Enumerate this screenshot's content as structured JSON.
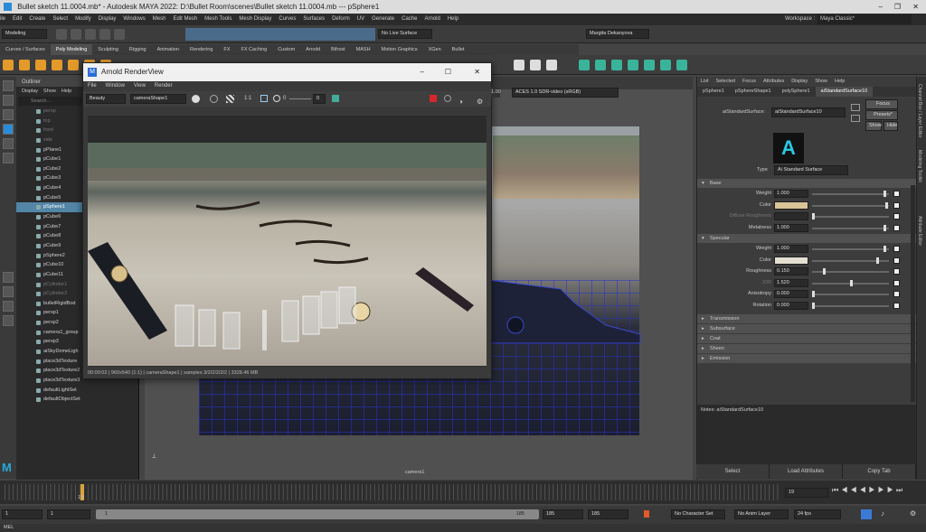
{
  "window": {
    "title": "Bullet sketch 11.0004.mb* - Autodesk MAYA 2022: D:\\Bullet Room\\scenes\\Bullet sketch 11.0004.mb  ---  pSphere1",
    "minimize": "–",
    "maximize": "❐",
    "close": "✕"
  },
  "menubar": [
    "ile",
    "Edit",
    "Create",
    "Select",
    "Modify",
    "Display",
    "Windows",
    "Mesh",
    "Edit Mesh",
    "Mesh Tools",
    "Mesh Display",
    "Curves",
    "Surfaces",
    "Deform",
    "UV",
    "Generate",
    "Cache",
    "Arnold",
    "Help"
  ],
  "workspace": {
    "label": "Workspace :",
    "value": "Maya Classic*"
  },
  "statusline": {
    "mode": "Modeling",
    "live_surface": "No Live Surface",
    "user": "Margita Dekanyova"
  },
  "shelf_tabs": [
    "Curves / Surfaces",
    "Poly Modeling",
    "Sculpting",
    "Rigging",
    "Animation",
    "Rendering",
    "FX",
    "FX Caching",
    "Custom",
    "Arnold",
    "Bifrost",
    "MASH",
    "Motion Graphics",
    "XGen",
    "Bullet"
  ],
  "shelf_active": "Poly Modeling",
  "outliner": {
    "title": "Outliner",
    "menu": [
      "Display",
      "Show",
      "Help"
    ],
    "search_placeholder": "Search...",
    "items": [
      {
        "label": "persp",
        "dim": true
      },
      {
        "label": "top",
        "dim": true
      },
      {
        "label": "front",
        "dim": true
      },
      {
        "label": "side",
        "dim": true
      },
      {
        "label": "pPlane1",
        "dim": false
      },
      {
        "label": "pCube1",
        "dim": false
      },
      {
        "label": "pCube2",
        "dim": false
      },
      {
        "label": "pCube3",
        "dim": false
      },
      {
        "label": "pCube4",
        "dim": false
      },
      {
        "label": "pCube5",
        "dim": false
      },
      {
        "label": "pSphere1",
        "dim": false,
        "selected": true
      },
      {
        "label": "pCube6",
        "dim": false
      },
      {
        "label": "pCube7",
        "dim": false
      },
      {
        "label": "pCube8",
        "dim": false
      },
      {
        "label": "pCube9",
        "dim": false
      },
      {
        "label": "pSphere2",
        "dim": false
      },
      {
        "label": "pCube10",
        "dim": false
      },
      {
        "label": "pCube11",
        "dim": false
      },
      {
        "label": "pCylinder1",
        "dim": true
      },
      {
        "label": "pCylinder2",
        "dim": true
      },
      {
        "label": "bulletRigidBod",
        "dim": false
      },
      {
        "label": "persp1",
        "dim": false
      },
      {
        "label": "persp2",
        "dim": false
      },
      {
        "label": "camera1_group",
        "dim": false
      },
      {
        "label": "persp3",
        "dim": false
      },
      {
        "label": "aiSkyDomeLigh",
        "dim": false
      },
      {
        "label": "place3dTexture",
        "dim": false
      },
      {
        "label": "place3dTexture2",
        "dim": false
      },
      {
        "label": "place3dTexture3",
        "dim": false
      },
      {
        "label": "defaultLightSet",
        "dim": false
      },
      {
        "label": "defaultObjectSet",
        "dim": false
      }
    ]
  },
  "render_view": {
    "title": "Arnold RenderView",
    "menu": [
      "File",
      "Window",
      "View",
      "Render"
    ],
    "aov": "Beauty",
    "camera": "cameraShape1",
    "ratio": "1:1",
    "exposure": "0",
    "gamma": "1.00",
    "view_transform": "ACES 1.0 SDR-video (sRGB)",
    "status": "00:00:02 | 960x540 (1:1) | cameraShape1 | samples 3/2/2/2/2/2 | 3328.46 MB"
  },
  "viewport": {
    "camera_label": "camera1"
  },
  "attribute_editor": {
    "menu": [
      "List",
      "Selected",
      "Focus",
      "Attributes",
      "Display",
      "Show",
      "Help"
    ],
    "node_tabs": [
      "pSphere1",
      "pSphereShape1",
      "polySphere1",
      "aiStandardSurface10"
    ],
    "active_tab": "aiStandardSurface10",
    "node_label": "aiStandardSurface:",
    "node_value": "aiStandardSurface10",
    "buttons": {
      "focus": "Focus",
      "presets": "Presets*",
      "show": "Show",
      "hide": "Hide"
    },
    "type_label": "Type",
    "type_value": "Ai Standard Surface",
    "sections": {
      "base": {
        "title": "Base",
        "rows": [
          {
            "label": "Weight",
            "value": "1.000",
            "knob": 0.95
          },
          {
            "label": "Color",
            "swatch": "#d9c497",
            "knob": 0.97
          },
          {
            "label": "Diffuse Roughness",
            "value": "",
            "dim": true,
            "knob": 0.0
          },
          {
            "label": "Metalness",
            "value": "1.000",
            "knob": 0.95
          }
        ]
      },
      "specular": {
        "title": "Specular",
        "rows": [
          {
            "label": "Weight",
            "value": "1.000",
            "knob": 0.95
          },
          {
            "label": "Color",
            "swatch": "#e4dfd2",
            "knob": 0.85
          },
          {
            "label": "Roughness",
            "value": "0.150",
            "knob": 0.15
          },
          {
            "label": "IOR",
            "value": "1.520",
            "dim": true,
            "knob": 0.5
          },
          {
            "label": "Anisotropy",
            "value": "0.000",
            "knob": 0.0
          },
          {
            "label": "Rotation",
            "value": "0.000",
            "knob": 0.0
          }
        ]
      },
      "collapsed": [
        "Transmission",
        "Subsurface",
        "Coat",
        "Sheen",
        "Emission"
      ]
    },
    "notes": "Notes:  aiStandardSurface10",
    "bottom_buttons": [
      "Select",
      "Load Attributes",
      "Copy Tab"
    ]
  },
  "vertical_tabs": [
    "Channel Box / Layer Editor",
    "Modeling Toolkit",
    "Attribute Editor"
  ],
  "timeline": {
    "current_frame": "19",
    "start": "1",
    "start2": "1",
    "range_start_marker": "1",
    "range_end_marker": "185",
    "end": "185",
    "end2": "185",
    "character_set": "No Character Set",
    "anim_layer": "No Anim Layer",
    "fps": "24 fps"
  },
  "cmdline": {
    "label": "MEL"
  },
  "colors": {
    "selection": "#5285a6",
    "accent_blue": "#3b7bd6",
    "render_red": "#d9262b"
  }
}
